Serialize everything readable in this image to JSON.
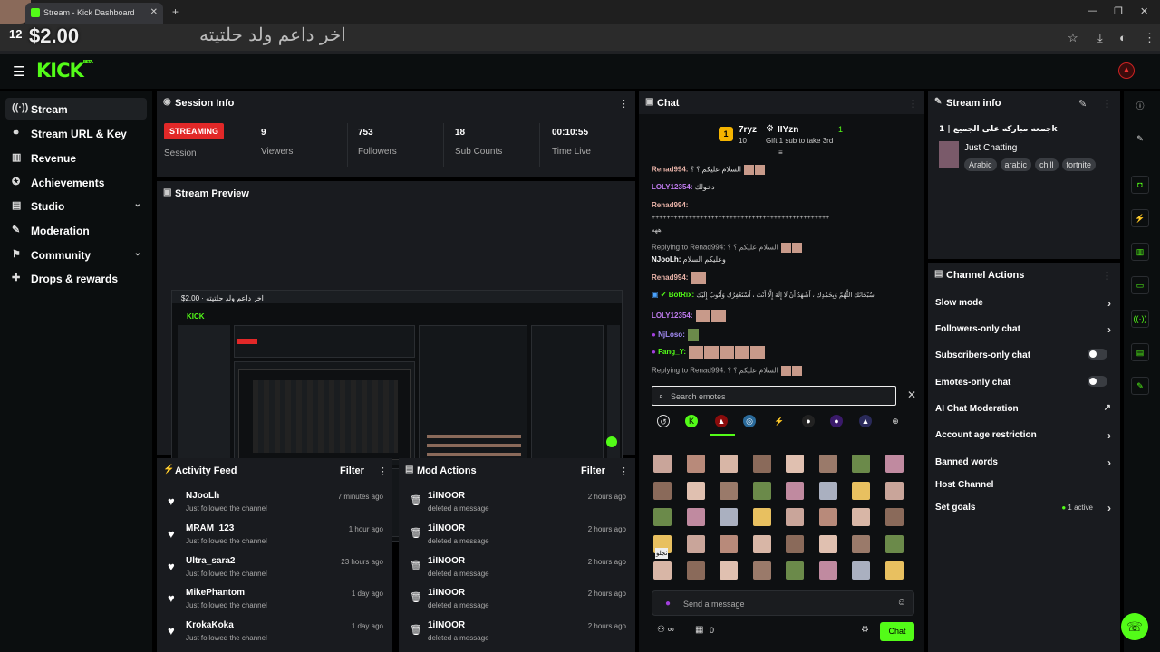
{
  "browser": {
    "tab_title": "Stream - Kick Dashboard",
    "overlay_text": "اخر داعم ولد حلتيته",
    "overlay_amount": "$2.00",
    "overlay_num": "12"
  },
  "sidebar": {
    "items": [
      {
        "label": "Stream",
        "icon": "stream-icon"
      },
      {
        "label": "Stream URL & Key",
        "icon": "link-icon"
      },
      {
        "label": "Revenue",
        "icon": "revenue-icon"
      },
      {
        "label": "Achievements",
        "icon": "trophy-icon"
      },
      {
        "label": "Studio",
        "icon": "studio-icon"
      },
      {
        "label": "Moderation",
        "icon": "moderation-icon"
      },
      {
        "label": "Community",
        "icon": "community-icon"
      },
      {
        "label": "Drops & rewards",
        "icon": "drops-icon"
      }
    ]
  },
  "logo": {
    "text": "KICK",
    "badge": "BETA"
  },
  "session": {
    "title": "Session Info",
    "status": "STREAMING",
    "status_label": "Session",
    "stats": [
      {
        "value": "9",
        "label": "Viewers"
      },
      {
        "value": "753",
        "label": "Followers"
      },
      {
        "value": "18",
        "label": "Sub Counts"
      },
      {
        "value": "00:10:55",
        "label": "Time Live"
      }
    ]
  },
  "preview": {
    "title": "Stream Preview"
  },
  "activity": {
    "title": "Activity Feed",
    "filter": "Filter",
    "rows": [
      {
        "name": "NJooLh",
        "sub": "Just followed the channel",
        "time": "7 minutes ago"
      },
      {
        "name": "MRAM_123",
        "sub": "Just followed the channel",
        "time": "1 hour ago"
      },
      {
        "name": "Ultra_sara2",
        "sub": "Just followed the channel",
        "time": "23 hours ago"
      },
      {
        "name": "MikePhantom",
        "sub": "Just followed the channel",
        "time": "1 day ago"
      },
      {
        "name": "KrokaKoka",
        "sub": "Just followed the channel",
        "time": "1 day ago"
      }
    ]
  },
  "modactions": {
    "title": "Mod Actions",
    "filter": "Filter",
    "rows": [
      {
        "name": "1iINOOR",
        "sub": "deleted a message",
        "time": "2 hours ago"
      },
      {
        "name": "1iINOOR",
        "sub": "deleted a message",
        "time": "2 hours ago"
      },
      {
        "name": "1iINOOR",
        "sub": "deleted a message",
        "time": "2 hours ago"
      },
      {
        "name": "1iINOOR",
        "sub": "deleted a message",
        "time": "2 hours ago"
      },
      {
        "name": "1iINOOR",
        "sub": "deleted a message",
        "time": "2 hours ago"
      }
    ]
  },
  "chat": {
    "title": "Chat",
    "pinned_rank": "1",
    "pinned_user1": "7ryz",
    "pinned_user1_count": "10",
    "pinned_user2": "IIYzn",
    "pinned_user2_count": "1",
    "pinned_msg": "Gift 1 sub to take 3rd",
    "messages": [
      {
        "user": "Renad994:",
        "text": "السلام عليكم ؟ ؟",
        "color": "#e9b3a8"
      },
      {
        "user": "LOLY12354:",
        "text": "دخولك",
        "color": "#c07cf0"
      },
      {
        "user": "Renad994:",
        "text": "",
        "color": "#e9b3a8"
      },
      {
        "user": "NJooLh:",
        "text": "وعليكم السلام",
        "color": "#ffffff"
      },
      {
        "user": "Renad994:",
        "text": "",
        "color": "#e9b3a8"
      },
      {
        "user": "BotRix:",
        "text": "سُبْحَانَكَ اللَّهُمَّ وَبِحَمْدِكَ ، أَشْهَدُ أَنْ لَا إِلَهَ إِلَّا أَنْتَ ، أَسْتَغْفِرُكَ وَأَتُوبُ إِلَيْكَ",
        "color": "#53fc18"
      },
      {
        "user": "LOLY12354:",
        "text": "",
        "color": "#c07cf0"
      },
      {
        "user": "NjLoso:",
        "text": "",
        "color": "#a48cf7"
      },
      {
        "user": "Fang_Y:",
        "text": "",
        "color": "#53fc18"
      }
    ],
    "repeat_line": "++++++++++++++++++++++++++++++++++++++++++++++++",
    "repeat_tail": "ههه",
    "reply1": "Replying to Renad994: السلام عليكم ؟ ؟",
    "reply2": "Replying to Renad994: السلام عليكم ؟ ؟",
    "emote_search_placeholder": "Search emotes",
    "send_placeholder": "Send a message",
    "count": "0",
    "chat_button": "Chat",
    "emote_text": "نجلو"
  },
  "streaminfo": {
    "title": "Stream info",
    "stream_title": "جمعه مباركه على الجميع | 1k",
    "category": "Just Chatting",
    "tags": [
      "Arabic",
      "arabic",
      "chill",
      "fortnite"
    ]
  },
  "channel_actions": {
    "title": "Channel Actions",
    "items": [
      {
        "label": "Slow mode",
        "kind": "chevron"
      },
      {
        "label": "Followers-only chat",
        "kind": "chevron"
      },
      {
        "label": "Subscribers-only chat",
        "kind": "toggle"
      },
      {
        "label": "Emotes-only chat",
        "kind": "toggle"
      },
      {
        "label": "AI Chat Moderation",
        "kind": "external"
      },
      {
        "label": "Account age restriction",
        "kind": "chevron"
      },
      {
        "label": "Banned words",
        "kind": "chevron"
      },
      {
        "label": "Host Channel",
        "kind": "none"
      },
      {
        "label": "Set goals",
        "kind": "chevron"
      }
    ],
    "goals_status": "1 active"
  },
  "colors": {
    "accent": "#53fc18",
    "live": "#e22828",
    "panel": "#191b1f"
  }
}
